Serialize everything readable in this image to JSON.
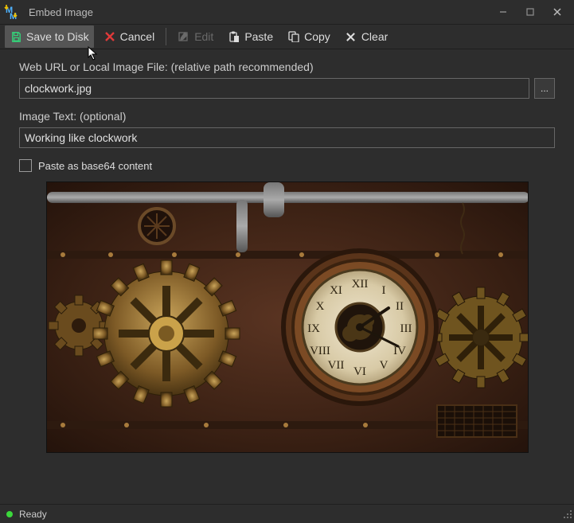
{
  "window": {
    "title": "Embed Image"
  },
  "toolbar": {
    "save": "Save to Disk",
    "cancel": "Cancel",
    "edit": "Edit",
    "paste": "Paste",
    "copy": "Copy",
    "clear": "Clear"
  },
  "labels": {
    "url_label": "Web URL or Local Image File: (relative path recommended)",
    "image_text_label": "Image Text: (optional)",
    "base64_label": "Paste as base64 content",
    "browse_btn": "..."
  },
  "fields": {
    "url_value": "clockwork.jpg",
    "image_text_value": "Working like clockwork"
  },
  "status": {
    "text": "Ready"
  }
}
